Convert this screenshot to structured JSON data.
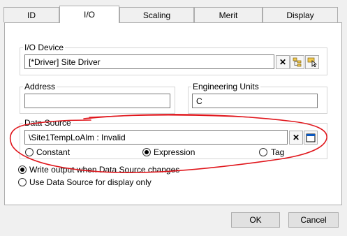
{
  "tabs": [
    {
      "label": "ID"
    },
    {
      "label": "I/O"
    },
    {
      "label": "Scaling"
    },
    {
      "label": "Merit"
    },
    {
      "label": "Display"
    }
  ],
  "io_device": {
    "legend": "I/O Device",
    "value": "[*Driver]    Site Driver"
  },
  "address": {
    "legend": "Address",
    "value": ""
  },
  "engineering_units": {
    "legend": "Engineering Units",
    "value": "C"
  },
  "data_source": {
    "legend": "Data Source",
    "value": "\\Site1TempLoAlm : Invalid",
    "options": [
      {
        "label": "Constant",
        "selected": false
      },
      {
        "label": "Expression",
        "selected": true
      },
      {
        "label": "Tag",
        "selected": false
      }
    ]
  },
  "write_options": [
    {
      "label": "Write output when Data Source changes",
      "selected": true
    },
    {
      "label": "Use Data Source for display only",
      "selected": false
    }
  ],
  "buttons": {
    "ok": "OK",
    "cancel": "Cancel"
  },
  "colors": {
    "annotation": "#e0151b",
    "accent": "#0a58c0"
  }
}
